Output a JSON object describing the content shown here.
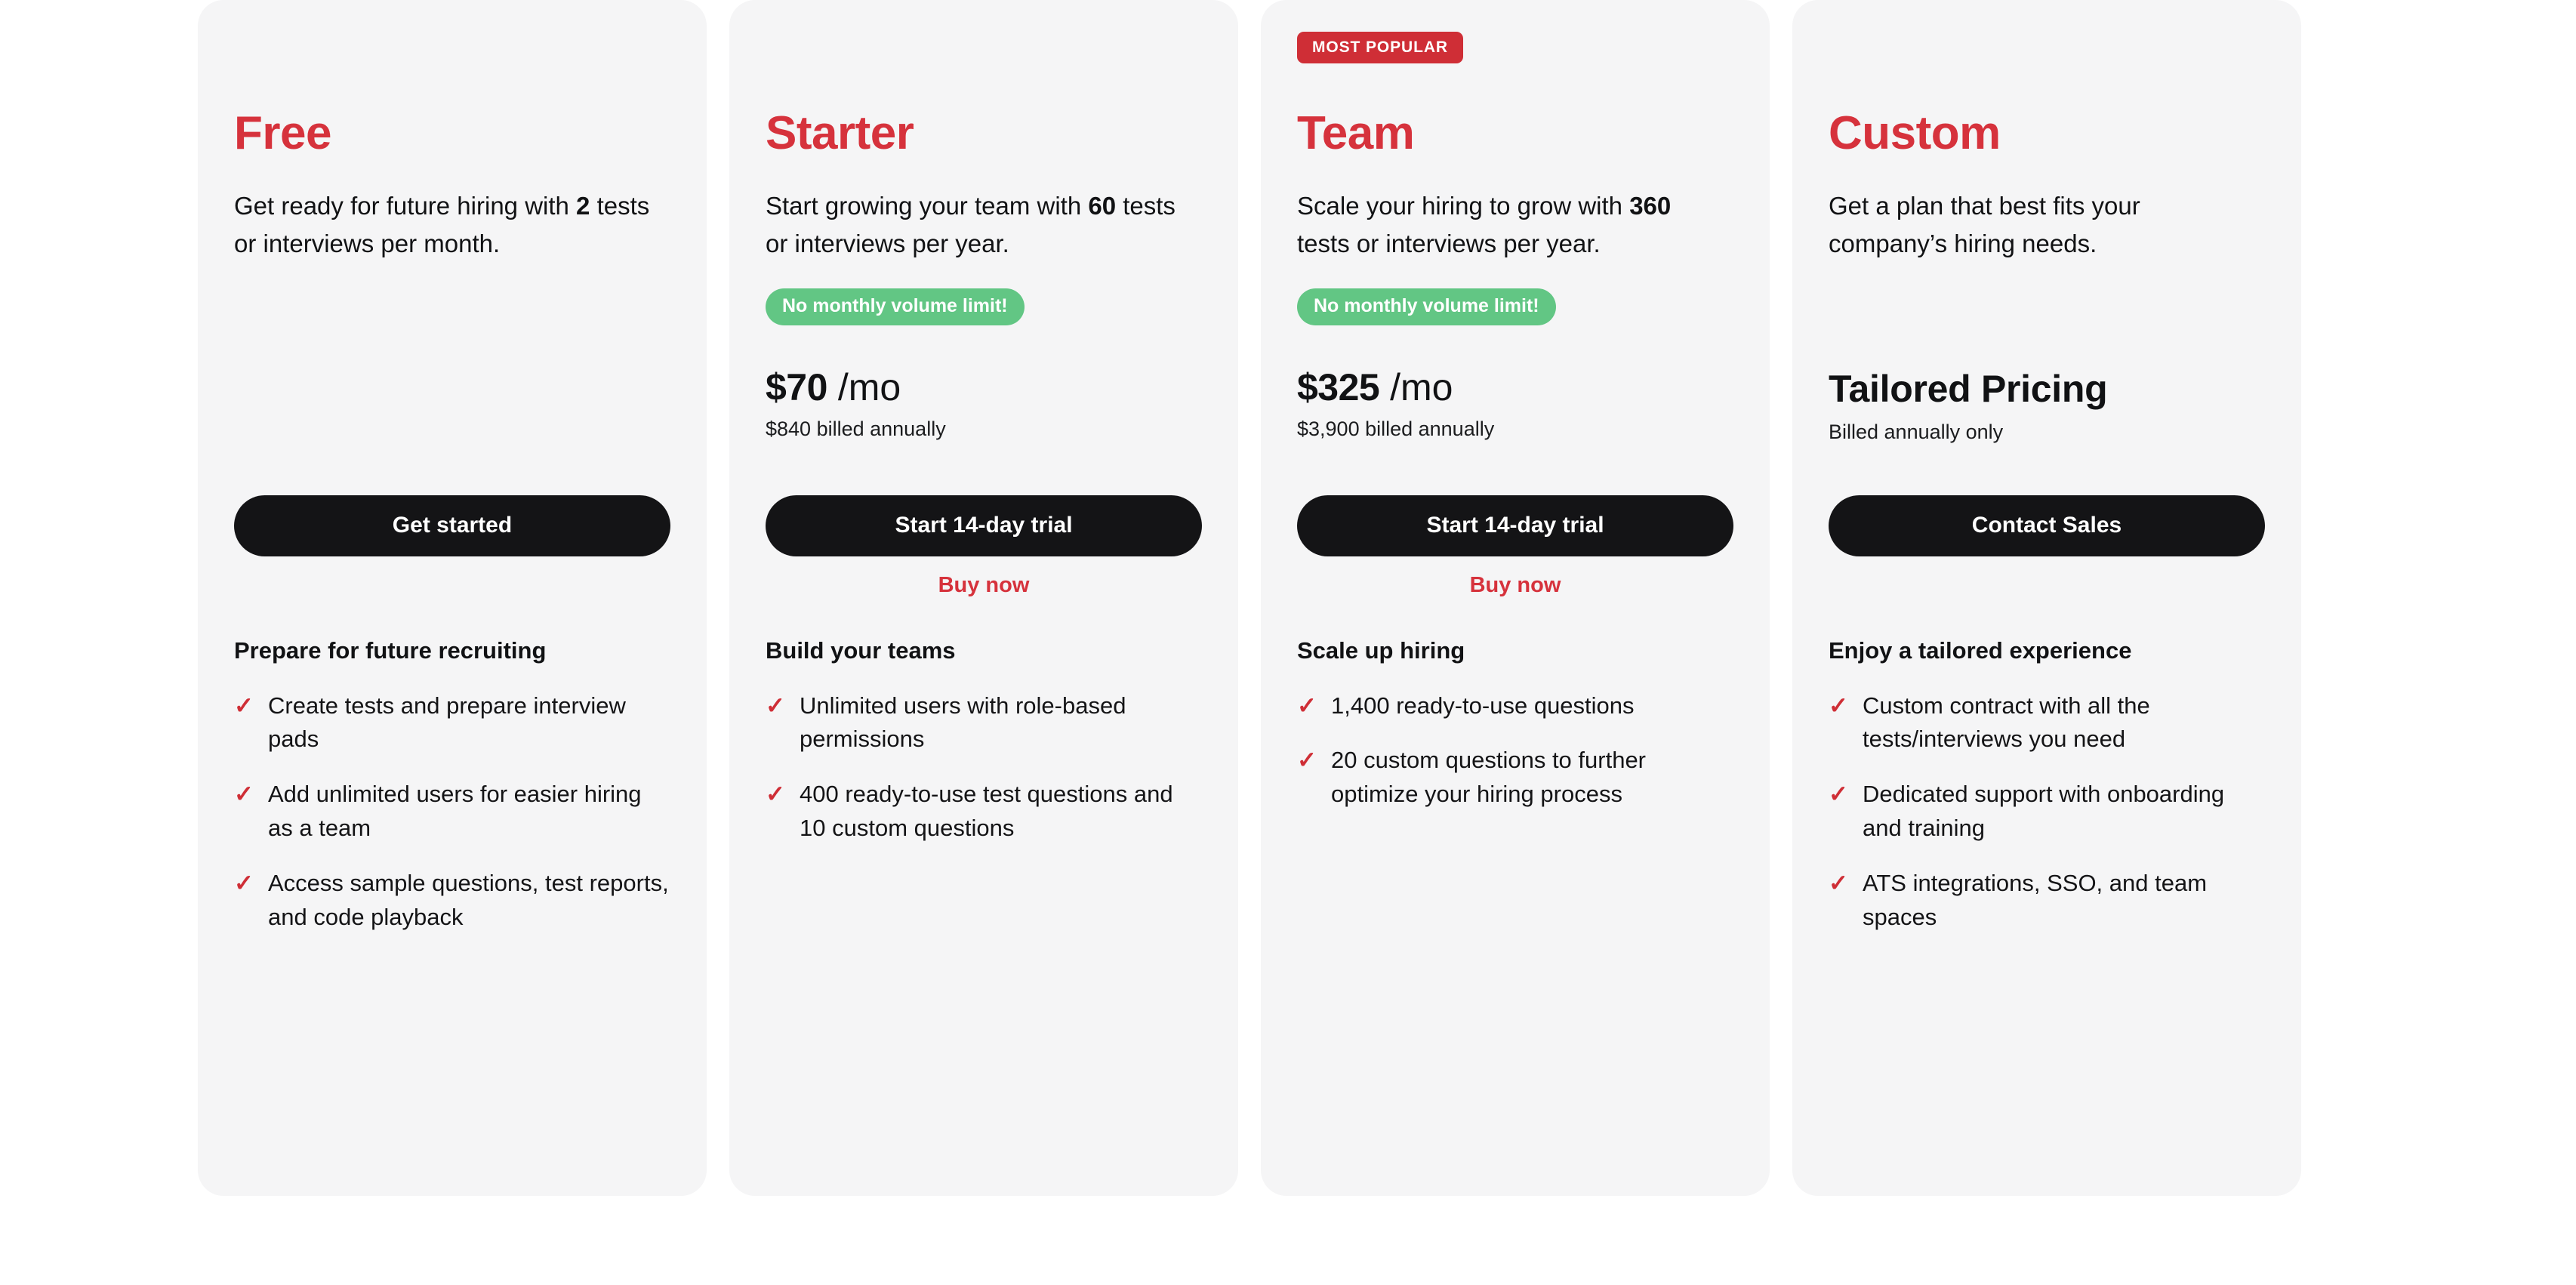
{
  "colors": {
    "brand_red": "#d6323c",
    "badge_red": "#cf2e36",
    "pill_green": "#62c684",
    "card_bg": "#f5f5f6",
    "page_bg": "#ffffff",
    "button_black": "#141416",
    "text_dark": "#111214"
  },
  "icons": {
    "check": "✓"
  },
  "plans": [
    {
      "badge": null,
      "name": "Free",
      "description_pre": "Get ready for future hiring with ",
      "description_bold": "2",
      "description_post": " tests or interviews per month.",
      "volume_pill": null,
      "price_amount": null,
      "price_period": null,
      "price_tailored": null,
      "price_note": null,
      "cta_label": "Get started",
      "secondary_link": null,
      "features_title": "Prepare for future recruiting",
      "features": [
        "Create tests and prepare interview pads",
        "Add unlimited users for easier hiring as a team",
        "Access sample questions, test reports, and code playback"
      ]
    },
    {
      "badge": null,
      "name": "Starter",
      "description_pre": "Start growing your team with ",
      "description_bold": "60",
      "description_post": " tests or interviews per year.",
      "volume_pill": "No monthly volume limit!",
      "price_amount": "$70",
      "price_period": " /mo",
      "price_tailored": null,
      "price_note": "$840 billed annually",
      "cta_label": "Start 14-day trial",
      "secondary_link": "Buy now",
      "features_title": "Build your teams",
      "features": [
        "Unlimited users with role-based permissions",
        "400 ready-to-use test questions and 10 custom questions"
      ]
    },
    {
      "badge": "MOST POPULAR",
      "name": "Team",
      "description_pre": "Scale your hiring to grow with ",
      "description_bold": "360",
      "description_post": " tests or interviews per year.",
      "volume_pill": "No monthly volume limit!",
      "price_amount": "$325",
      "price_period": " /mo",
      "price_tailored": null,
      "price_note": "$3,900 billed annually",
      "cta_label": "Start 14-day trial",
      "secondary_link": "Buy now",
      "features_title": "Scale up hiring",
      "features": [
        "1,400 ready-to-use questions",
        "20 custom questions to further optimize your hiring process"
      ]
    },
    {
      "badge": null,
      "name": "Custom",
      "description_pre": "Get a plan that best fits your company’s hiring needs.",
      "description_bold": null,
      "description_post": null,
      "volume_pill": null,
      "price_amount": null,
      "price_period": null,
      "price_tailored": "Tailored Pricing",
      "price_note": "Billed annually only",
      "cta_label": "Contact Sales",
      "secondary_link": null,
      "features_title": "Enjoy a tailored experience",
      "features": [
        "Custom contract with all the tests/interviews you need",
        "Dedicated support with onboarding and training",
        "ATS integrations, SSO, and team spaces"
      ]
    }
  ]
}
